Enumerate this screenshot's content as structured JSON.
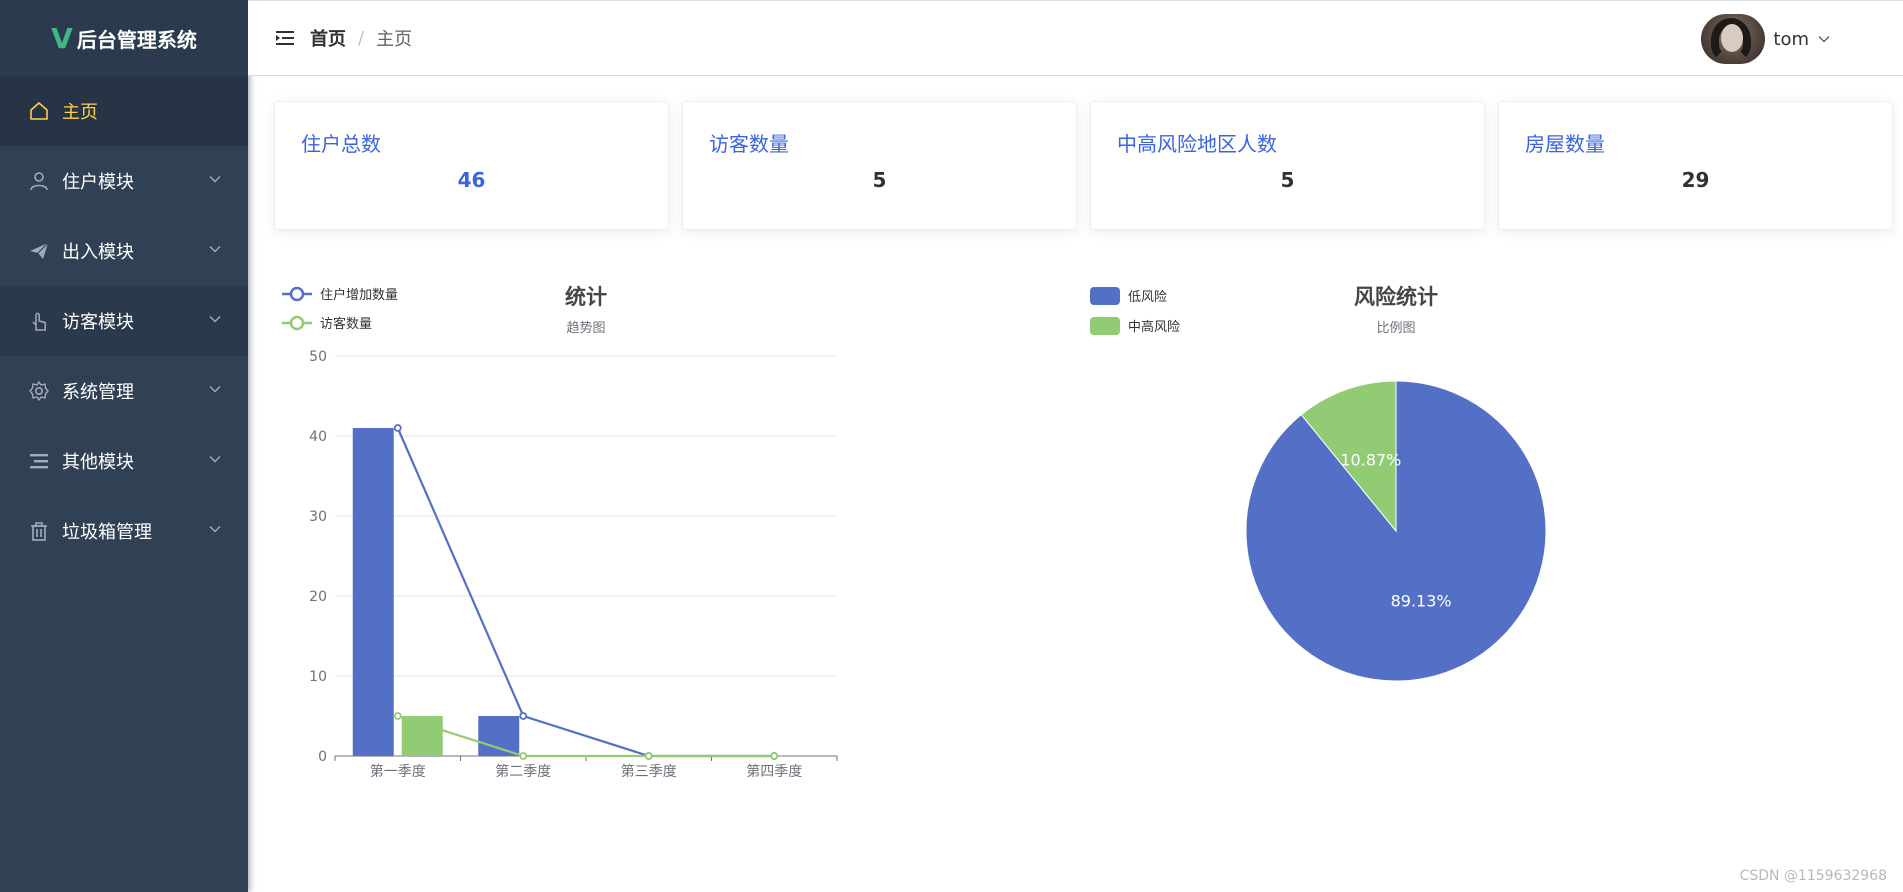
{
  "app": {
    "title": "后台管理系统",
    "logo_mark": "V"
  },
  "sidebar": {
    "items": [
      {
        "label": "主页",
        "icon": "home-icon",
        "active": true,
        "expandable": false
      },
      {
        "label": "住户模块",
        "icon": "user-icon",
        "active": false,
        "expandable": true
      },
      {
        "label": "出入模块",
        "icon": "send-icon",
        "active": false,
        "expandable": true
      },
      {
        "label": "访客模块",
        "icon": "hand-pointer-icon",
        "active": false,
        "expandable": true
      },
      {
        "label": "系统管理",
        "icon": "gear-icon",
        "active": false,
        "expandable": true
      },
      {
        "label": "其他模块",
        "icon": "list-icon",
        "active": false,
        "expandable": true
      },
      {
        "label": "垃圾箱管理",
        "icon": "trash-icon",
        "active": false,
        "expandable": true
      }
    ]
  },
  "header": {
    "breadcrumb": {
      "home": "首页",
      "separator": "/",
      "current": "主页"
    },
    "user": {
      "name": "tom"
    }
  },
  "stats": [
    {
      "label": "住户总数",
      "value": "46"
    },
    {
      "label": "访客数量",
      "value": "5"
    },
    {
      "label": "中高风险地区人数",
      "value": "5"
    },
    {
      "label": "房屋数量",
      "value": "29"
    }
  ],
  "colors": {
    "blue": "#5470c6",
    "green": "#91cc75",
    "accent": "#3a63e0",
    "sidebar_bg": "#304156",
    "active_text": "#ffd04b"
  },
  "chart_data": [
    {
      "type": "bar",
      "title": "统计",
      "subtitle": "趋势图",
      "categories": [
        "第一季度",
        "第二季度",
        "第三季度",
        "第四季度"
      ],
      "ylim": [
        0,
        50
      ],
      "yticks": [
        0,
        10,
        20,
        30,
        40,
        50
      ],
      "grid": true,
      "legend_position": "top-left",
      "series": [
        {
          "name": "住户增加数量",
          "color": "#5470c6",
          "values": [
            41,
            5,
            0,
            0
          ],
          "render": "bar+line"
        },
        {
          "name": "访客数量",
          "color": "#91cc75",
          "values": [
            5,
            0,
            0,
            0
          ],
          "render": "bar+line"
        }
      ]
    },
    {
      "type": "pie",
      "title": "风险统计",
      "subtitle": "比例图",
      "legend_position": "top-left",
      "slices": [
        {
          "name": "低风险",
          "value": 41,
          "label": "89.13%",
          "color": "#5470c6"
        },
        {
          "name": "中高风险",
          "value": 5,
          "label": "10.87%",
          "color": "#91cc75"
        }
      ]
    }
  ],
  "footer": {
    "watermark": "CSDN @1159632968"
  }
}
